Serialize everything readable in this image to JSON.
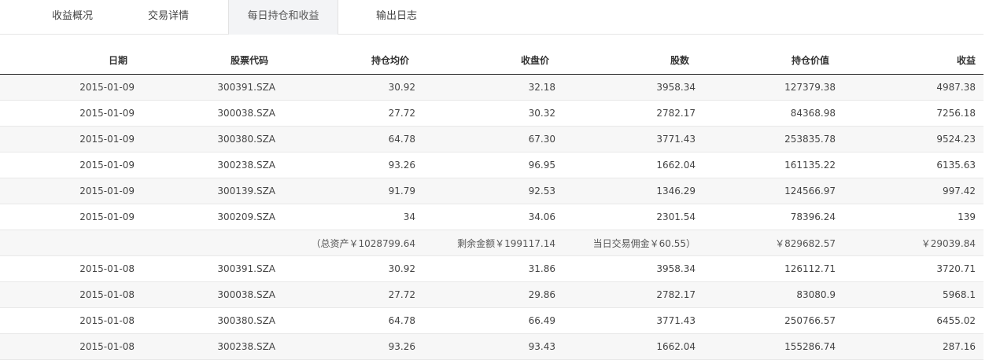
{
  "tabs": [
    {
      "label": "收益概况"
    },
    {
      "label": "交易详情"
    },
    {
      "label": "每日持仓和收益"
    },
    {
      "label": "输出日志"
    }
  ],
  "active_tab": 2,
  "table": {
    "columns": [
      "日期",
      "股票代码",
      "持仓均价",
      "收盘价",
      "股数",
      "持仓价值",
      "收益"
    ],
    "rows": [
      {
        "type": "data",
        "cells": [
          "2015-01-09",
          "300391.SZA",
          "30.92",
          "32.18",
          "3958.34",
          "127379.38",
          "4987.38"
        ]
      },
      {
        "type": "data",
        "cells": [
          "2015-01-09",
          "300038.SZA",
          "27.72",
          "30.32",
          "2782.17",
          "84368.98",
          "7256.18"
        ]
      },
      {
        "type": "data",
        "cells": [
          "2015-01-09",
          "300380.SZA",
          "64.78",
          "67.30",
          "3771.43",
          "253835.78",
          "9524.23"
        ]
      },
      {
        "type": "data",
        "cells": [
          "2015-01-09",
          "300238.SZA",
          "93.26",
          "96.95",
          "1662.04",
          "161135.22",
          "6135.63"
        ]
      },
      {
        "type": "data",
        "cells": [
          "2015-01-09",
          "300139.SZA",
          "91.79",
          "92.53",
          "1346.29",
          "124566.97",
          "997.42"
        ]
      },
      {
        "type": "data",
        "cells": [
          "2015-01-09",
          "300209.SZA",
          "34",
          "34.06",
          "2301.54",
          "78396.24",
          "139"
        ]
      },
      {
        "type": "summary",
        "cells": [
          "",
          "",
          "（总资产￥1028799.64",
          "剩余金额￥199117.14",
          "当日交易佣金￥60.55）",
          "￥829682.57",
          "￥29039.84"
        ]
      },
      {
        "type": "data",
        "cells": [
          "2015-01-08",
          "300391.SZA",
          "30.92",
          "31.86",
          "3958.34",
          "126112.71",
          "3720.71"
        ]
      },
      {
        "type": "data",
        "cells": [
          "2015-01-08",
          "300038.SZA",
          "27.72",
          "29.86",
          "2782.17",
          "83080.9",
          "5968.1"
        ]
      },
      {
        "type": "data",
        "cells": [
          "2015-01-08",
          "300380.SZA",
          "64.78",
          "66.49",
          "3771.43",
          "250766.57",
          "6455.02"
        ]
      },
      {
        "type": "data",
        "cells": [
          "2015-01-08",
          "300238.SZA",
          "93.26",
          "93.43",
          "1662.04",
          "155286.74",
          "287.16"
        ]
      }
    ]
  }
}
